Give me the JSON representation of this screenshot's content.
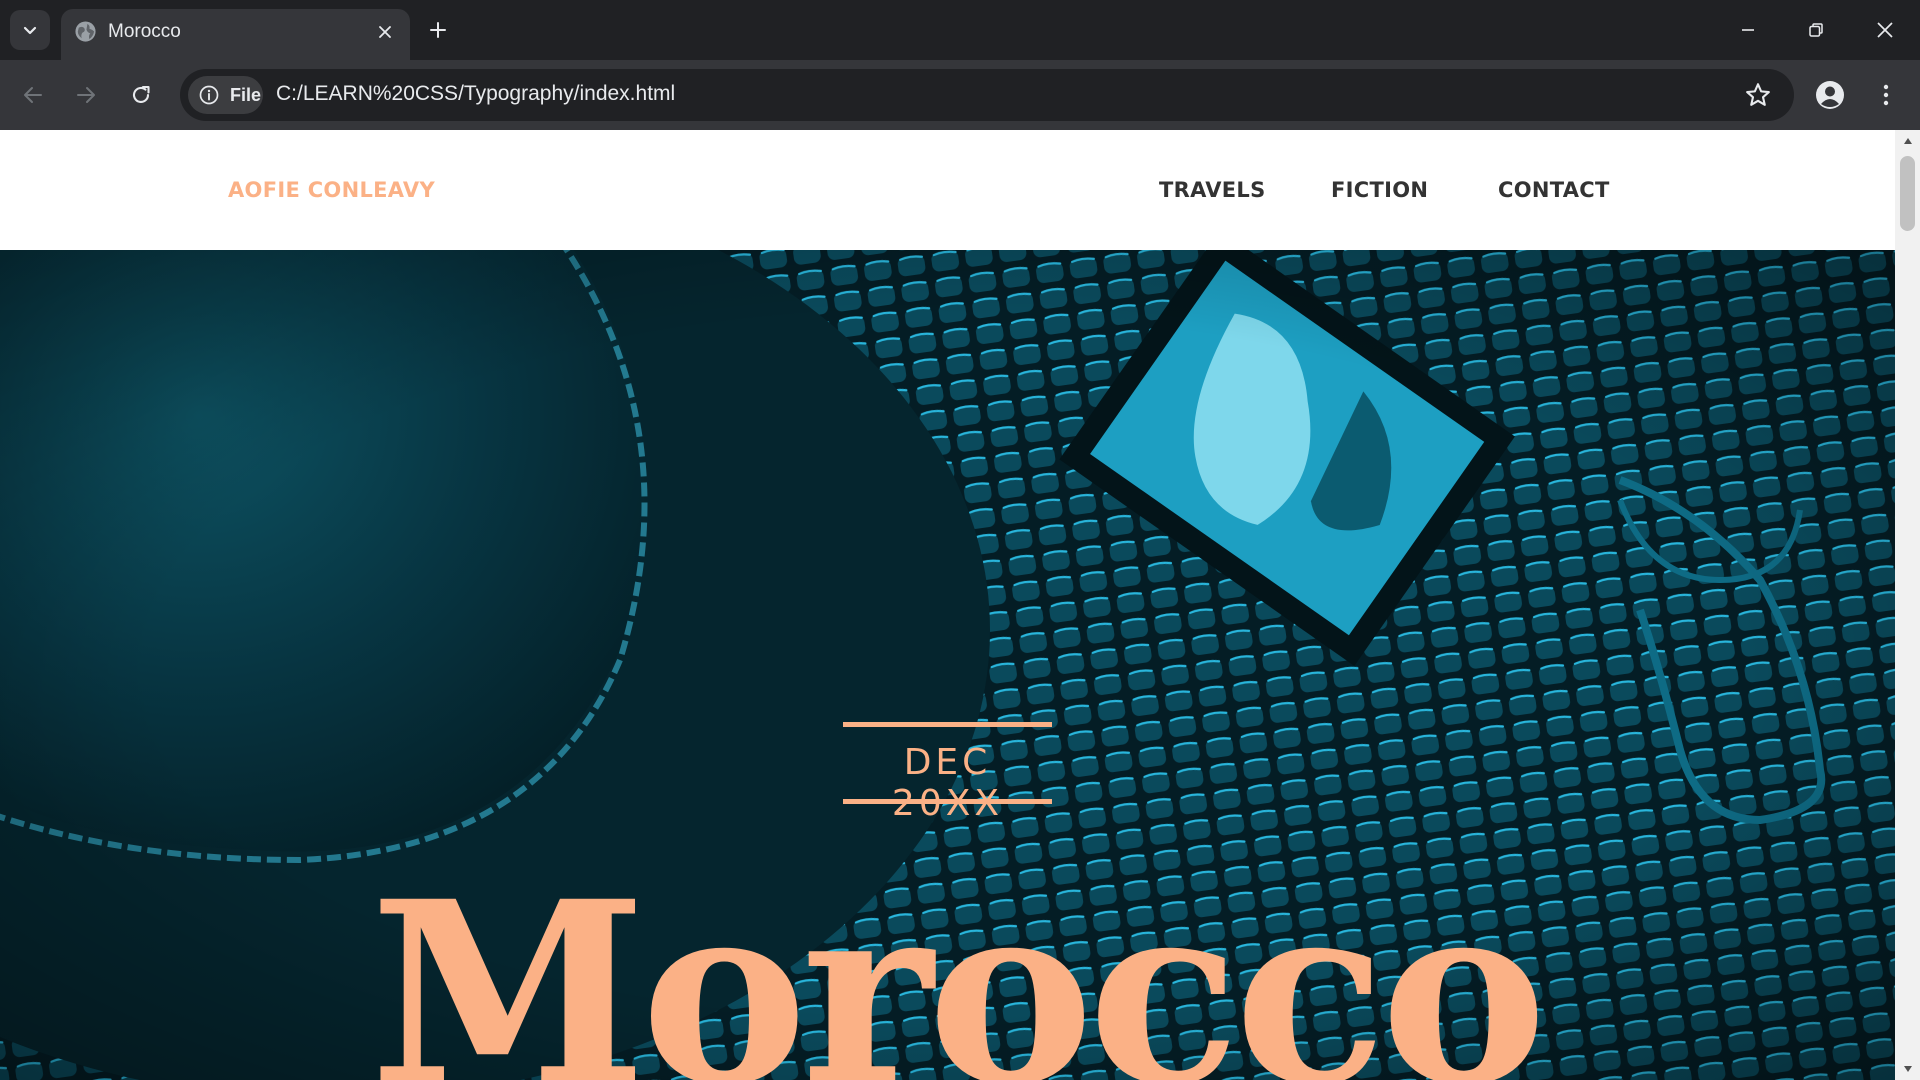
{
  "browser": {
    "tab": {
      "title": "Morocco"
    },
    "address": {
      "chip_label": "File",
      "url": "C:/LEARN%20CSS/Typography/index.html"
    }
  },
  "site": {
    "brand": "AOFIE CONLEAVY",
    "nav": [
      "TRAVELS",
      "FICTION",
      "CONTACT"
    ],
    "hero": {
      "date": "DEC 20XX",
      "title": "Morocco"
    }
  },
  "colors": {
    "accent": "#fbb186",
    "nav_text": "#333333",
    "hero_base": "#05222b",
    "hero_highlight": "#1aa3c4"
  },
  "icons": [
    "tab-search-icon",
    "globe-icon",
    "close-icon",
    "plus-icon",
    "minimize-icon",
    "restore-icon",
    "back-arrow-icon",
    "forward-arrow-icon",
    "reload-icon",
    "info-icon",
    "star-icon",
    "profile-icon",
    "kebab-menu-icon"
  ]
}
